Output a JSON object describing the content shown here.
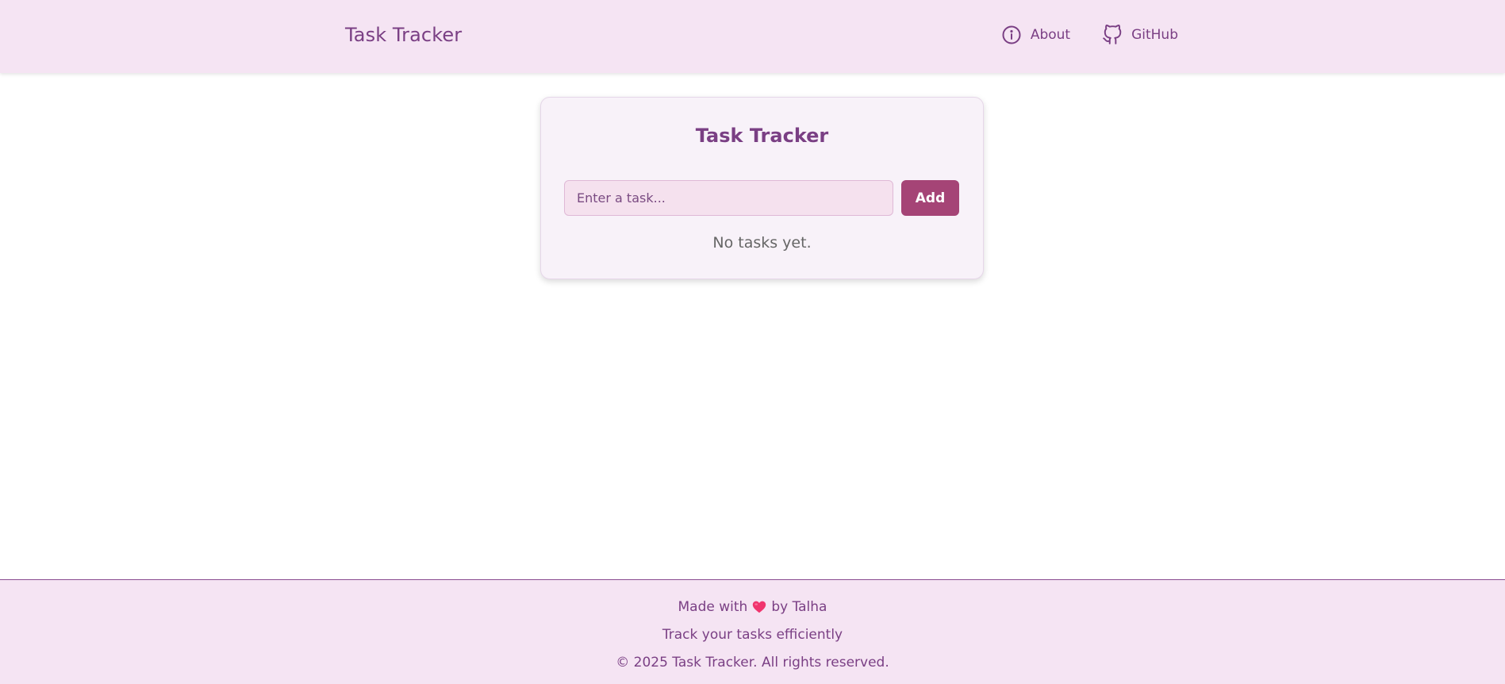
{
  "header": {
    "brand": "Task Tracker",
    "nav": {
      "about_label": "About",
      "about_icon": "info-circle-icon",
      "github_label": "GitHub",
      "github_icon": "github-icon"
    }
  },
  "card": {
    "title": "Task Tracker",
    "input_value": "",
    "input_placeholder": "Enter a task...",
    "add_label": "Add",
    "empty_message": "No tasks yet."
  },
  "footer": {
    "made_with_prefix": "Made with",
    "heart_icon": "heart-icon",
    "made_with_suffix": "by Talha",
    "tagline": "Track your tasks efficiently",
    "copyright": "© 2025 Task Tracker. All rights reserved."
  },
  "colors": {
    "header_bg": "#f5e4f3",
    "brand_text": "#7a3f84",
    "card_bg": "#f8f2f9",
    "input_bg": "#f5e1ee",
    "add_button_bg": "#a54476",
    "heart": "#f0356e",
    "muted_text": "#666666"
  }
}
